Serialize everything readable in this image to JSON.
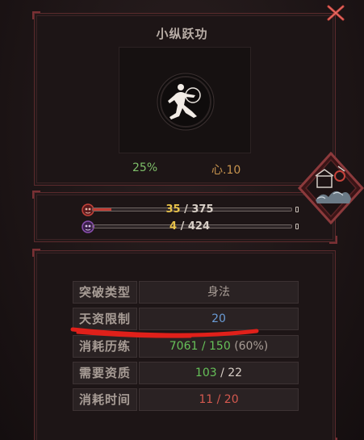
{
  "skill": {
    "name": "小纵跃功",
    "progress": "25%",
    "mind": "心.10"
  },
  "bars": [
    {
      "current": "35",
      "sep": " / ",
      "max": "375",
      "fill_ratio": 0.0933,
      "color": "#c23c33"
    },
    {
      "current": "4",
      "sep": " / ",
      "max": "424",
      "fill_ratio": 0.0094,
      "color": "#8a4fb0"
    }
  ],
  "info": {
    "breakthrough_type": {
      "label": "突破类型",
      "value": "身法"
    },
    "talent_limit": {
      "label": "天资限制",
      "value": "20"
    },
    "experience_cost": {
      "label": "消耗历练",
      "value_main": "7061 / 150",
      "value_pct": "(60%)"
    },
    "required_talent": {
      "label": "需要资质",
      "value_cur": "103",
      "value_rest": " / 22"
    },
    "time_cost": {
      "label": "消耗时间",
      "value": "11 / 20"
    }
  },
  "icons": {
    "close": "close-x-icon",
    "skill": "martial-artist-silhouette-icon",
    "hp": "red-mask-icon",
    "mp": "purple-mask-icon",
    "emblem": "landscape-emblem-icon"
  },
  "colors": {
    "accent_red": "#c23c33",
    "frame_red": "#7a3034",
    "gold": "#e8c24a",
    "green": "#66c159",
    "blue": "#6a9bd4"
  }
}
